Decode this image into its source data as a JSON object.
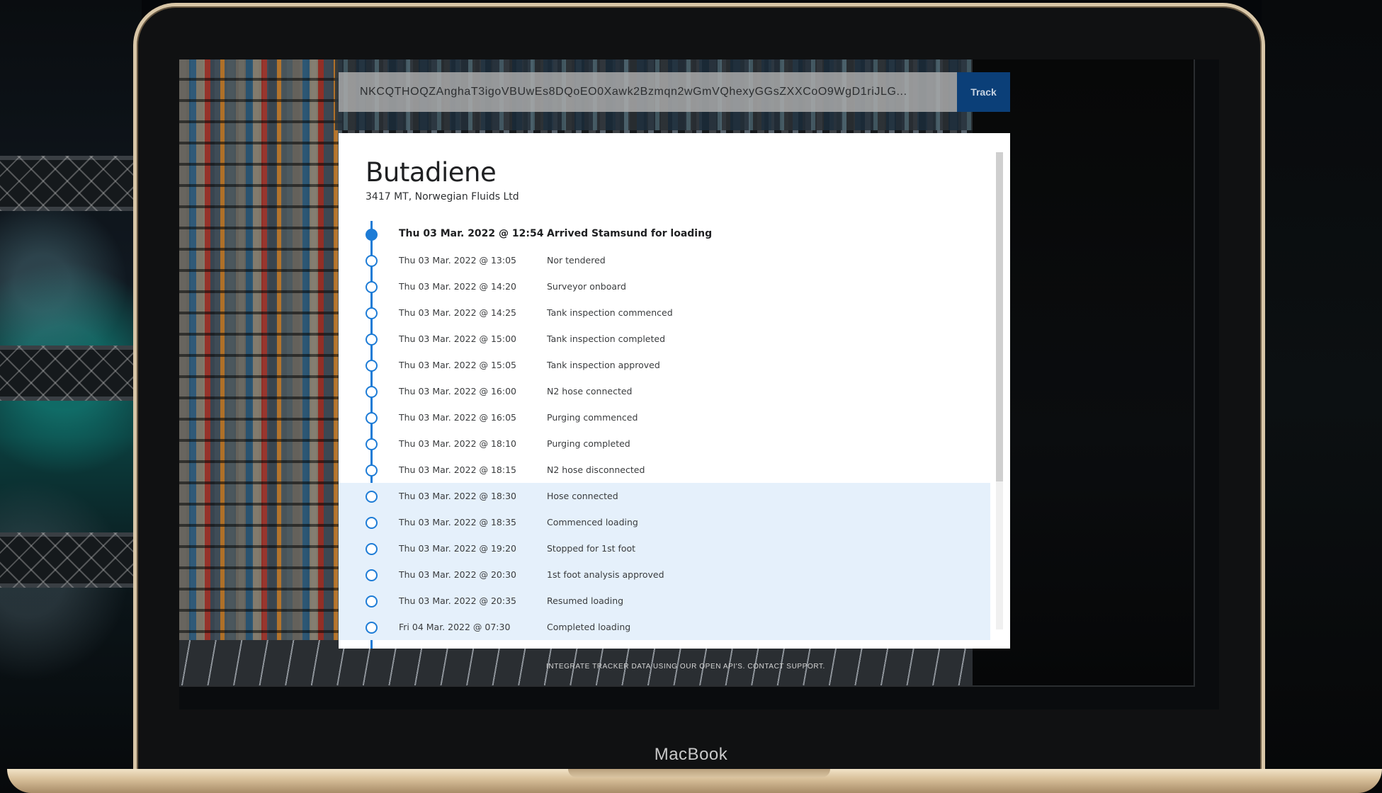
{
  "tracking": {
    "id_value": "NKCQTHOQZAnghaT3igoVBUwEs8DQoEO0Xawk2Bzmqn2wGmVQhexyGGsZXXCoO9WgD1riJLG...",
    "track_label": "Track"
  },
  "cargo": {
    "product": "Butadiene",
    "details": "3417 MT, Norwegian Fluids Ltd"
  },
  "events": [
    {
      "time": "Thu 03 Mar. 2022 @ 12:54",
      "desc": "Arrived Stamsund for loading"
    },
    {
      "time": "Thu 03 Mar. 2022 @ 13:05",
      "desc": "Nor tendered"
    },
    {
      "time": "Thu 03 Mar. 2022 @ 14:20",
      "desc": "Surveyor onboard"
    },
    {
      "time": "Thu 03 Mar. 2022 @ 14:25",
      "desc": "Tank inspection commenced"
    },
    {
      "time": "Thu 03 Mar. 2022 @ 15:00",
      "desc": "Tank inspection completed"
    },
    {
      "time": "Thu 03 Mar. 2022 @ 15:05",
      "desc": "Tank inspection approved"
    },
    {
      "time": "Thu 03 Mar. 2022 @ 16:00",
      "desc": "N2 hose connected"
    },
    {
      "time": "Thu 03 Mar. 2022 @ 16:05",
      "desc": "Purging commenced"
    },
    {
      "time": "Thu 03 Mar. 2022 @ 18:10",
      "desc": "Purging completed"
    },
    {
      "time": "Thu 03 Mar. 2022 @ 18:15",
      "desc": "N2 hose disconnected"
    },
    {
      "time": "Thu 03 Mar. 2022 @ 18:30",
      "desc": "Hose connected"
    },
    {
      "time": "Thu 03 Mar. 2022 @ 18:35",
      "desc": "Commenced loading"
    },
    {
      "time": "Thu 03 Mar. 2022 @ 19:20",
      "desc": "Stopped for 1st foot"
    },
    {
      "time": "Thu 03 Mar. 2022 @ 20:30",
      "desc": "1st foot analysis approved"
    },
    {
      "time": "Thu 03 Mar. 2022 @ 20:35",
      "desc": "Resumed loading"
    },
    {
      "time": "Fri 04 Mar. 2022 @ 07:30",
      "desc": "Completed loading"
    }
  ],
  "footer": {
    "text": "INTEGRATE TRACKER DATA USING OUR OPEN API'S. CONTACT SUPPORT."
  },
  "device": {
    "brand": "MacBook"
  },
  "colors": {
    "accent": "#1e7cd6",
    "track_button": "#0b3f78",
    "highlight_row": "#e5f0fb"
  }
}
